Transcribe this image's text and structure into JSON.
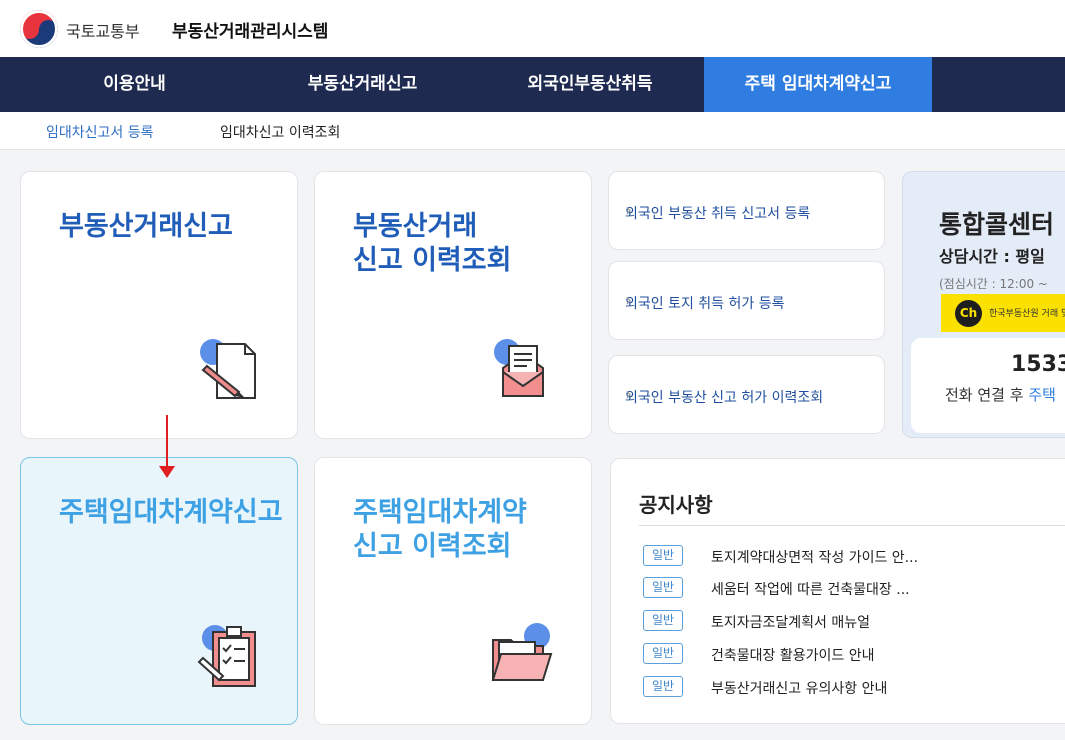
{
  "header": {
    "ministry": "국토교통부",
    "system_title": "부동산거래관리시스템"
  },
  "nav": {
    "tabs": [
      {
        "label": "이용안내"
      },
      {
        "label": "부동산거래신고"
      },
      {
        "label": "외국인부동산취득"
      },
      {
        "label": "주택 임대차계약신고",
        "active": true
      }
    ]
  },
  "subnav": {
    "items": [
      {
        "label": "임대차신고서 등록",
        "active": true
      },
      {
        "label": "임대차신고 이력조회"
      }
    ]
  },
  "cards": {
    "real_estate_report": {
      "line1": "부동산거래신고"
    },
    "real_estate_history": {
      "line1": "부동산거래",
      "line2": "신고 이력조회"
    },
    "lease_report": {
      "line1": "주택임대차계약신고"
    },
    "lease_history": {
      "line1": "주택임대차계약",
      "line2": "신고 이력조회"
    }
  },
  "foreign_links": [
    {
      "label": "외국인 부동산 취득 신고서 등록"
    },
    {
      "label": "외국인 토지 취득 허가 등록"
    },
    {
      "label": "외국인 부동산 신고 허가 이력조회"
    }
  ],
  "call_center": {
    "title": "통합콜센터",
    "hours": "상담시간 : 평일",
    "lunch": "(점심시간 : 12:00 ~",
    "kakao_label": "Ch",
    "kakao_text": "한국부동산원 거래 및",
    "phone": "1533-",
    "connect_prefix": "전화 연결 후",
    "connect_suffix": "주택"
  },
  "notice": {
    "heading": "공지사항",
    "items": [
      {
        "badge": "일반",
        "text": "토지계약대상면적 작성 가이드 안..."
      },
      {
        "badge": "일반",
        "text": "세움터 작업에 따른 건축물대장 ..."
      },
      {
        "badge": "일반",
        "text": "토지자금조달계획서 매뉴얼"
      },
      {
        "badge": "일반",
        "text": "건축물대장 활용가이드 안내"
      },
      {
        "badge": "일반",
        "text": "부동산거래신고 유의사항 안내"
      }
    ]
  },
  "colors": {
    "nav_bg": "#1e2a4f",
    "nav_active": "#2f7de1",
    "title_dark_blue": "#1f5db8",
    "title_light_blue": "#3ea1e4",
    "annotation_arrow": "#e02020"
  }
}
